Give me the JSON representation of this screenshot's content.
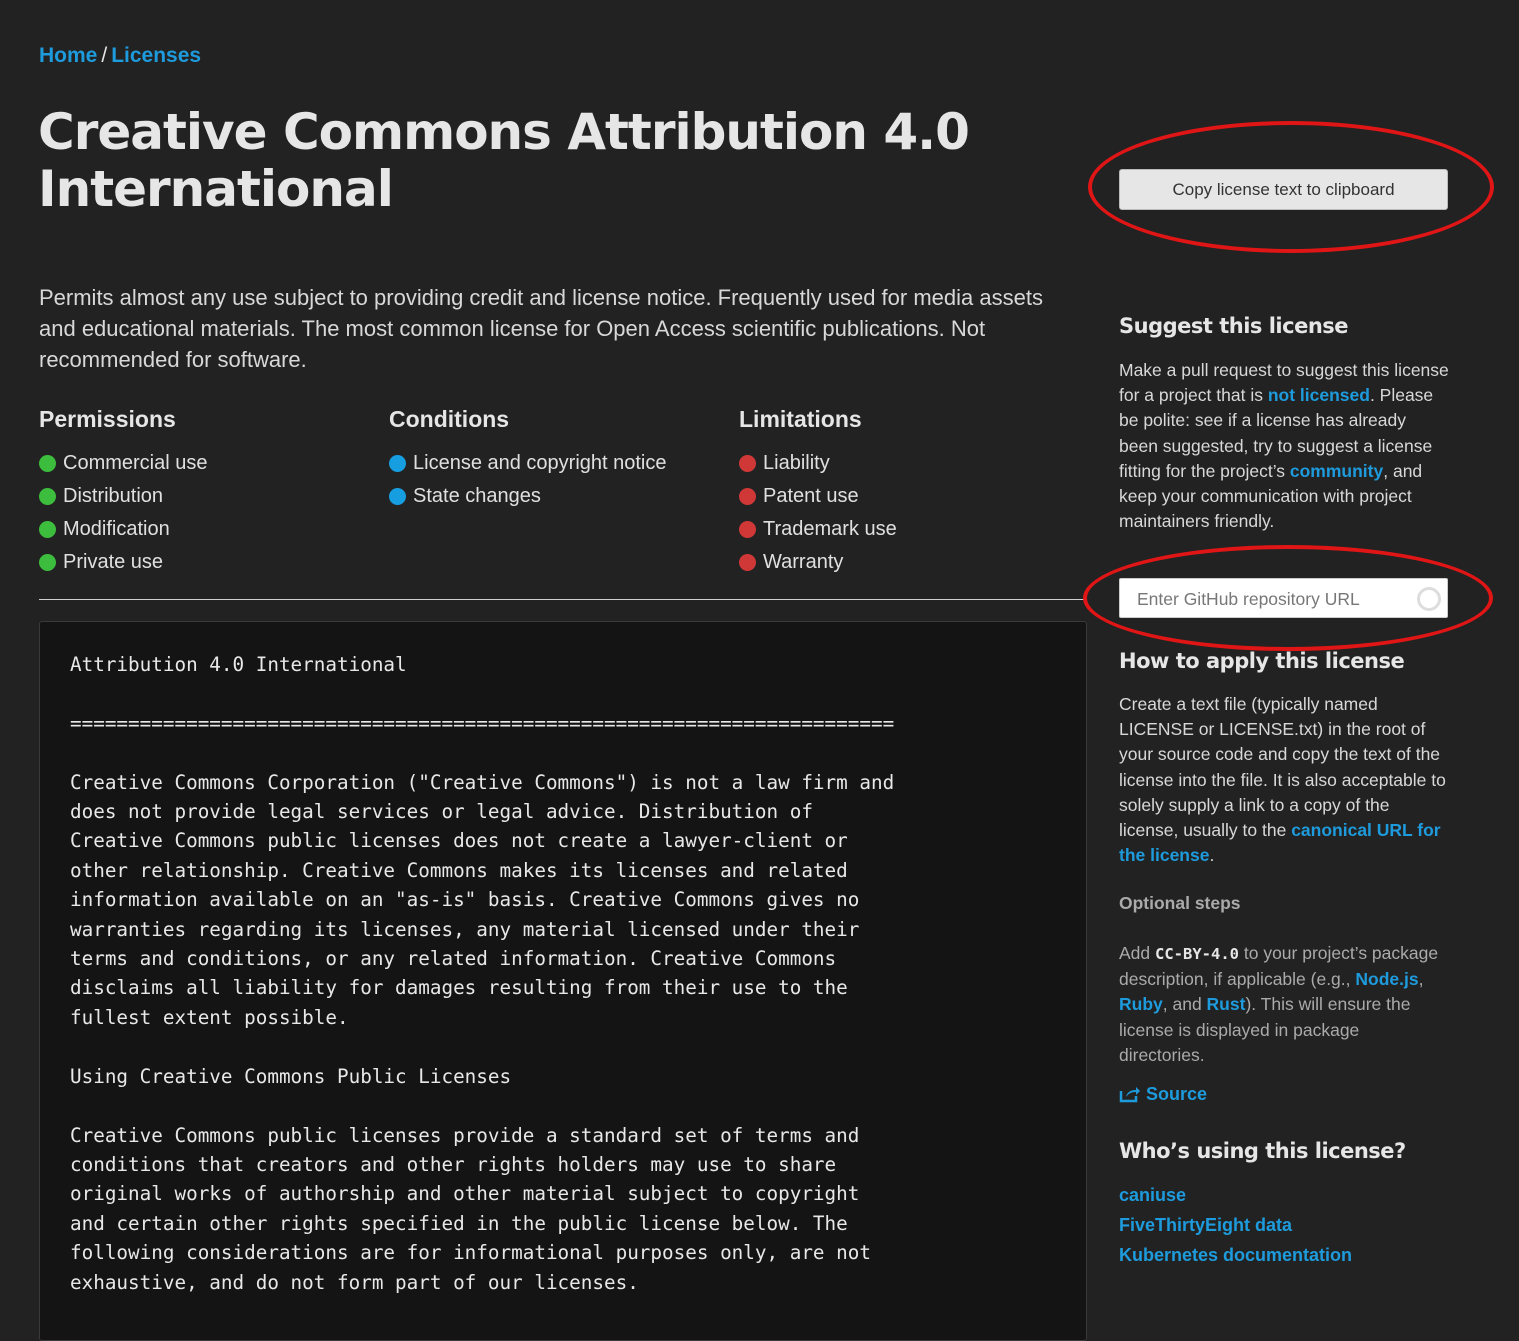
{
  "breadcrumb": {
    "home": "Home",
    "separator": "/",
    "current": "Licenses"
  },
  "title": "Creative Commons Attribution 4.0 International",
  "summary": "Permits almost any use subject to providing credit and license notice. Frequently used for media assets and educational materials. The most common license for Open Access scientific publications. Not recommended for software.",
  "rules": {
    "permissions": {
      "heading": "Permissions",
      "color": "#3dbd3d",
      "items": [
        "Commercial use",
        "Distribution",
        "Modification",
        "Private use"
      ]
    },
    "conditions": {
      "heading": "Conditions",
      "color": "#169ee0",
      "items": [
        "License and copyright notice",
        "State changes"
      ]
    },
    "limitations": {
      "heading": "Limitations",
      "color": "#d03838",
      "items": [
        "Liability",
        "Patent use",
        "Trademark use",
        "Warranty"
      ]
    }
  },
  "license_text": "Attribution 4.0 International\n\n=======================================================================\n\nCreative Commons Corporation (\"Creative Commons\") is not a law firm and\ndoes not provide legal services or legal advice. Distribution of\nCreative Commons public licenses does not create a lawyer-client or\nother relationship. Creative Commons makes its licenses and related\ninformation available on an \"as-is\" basis. Creative Commons gives no\nwarranties regarding its licenses, any material licensed under their\nterms and conditions, or any related information. Creative Commons\ndisclaims all liability for damages resulting from their use to the\nfullest extent possible.\n\nUsing Creative Commons Public Licenses\n\nCreative Commons public licenses provide a standard set of terms and\nconditions that creators and other rights holders may use to share\noriginal works of authorship and other material subject to copyright\nand certain other rights specified in the public license below. The\nfollowing considerations are for informational purposes only, are not\nexhaustive, and do not form part of our licenses.",
  "sidebar": {
    "copy_button": "Copy license text to clipboard",
    "suggest": {
      "heading": "Suggest this license",
      "text1": "Make a pull request to suggest this license for a project that is ",
      "link1": "not licensed",
      "text2": ". Please be polite: see if a license has already been suggested, try to suggest a license fitting for the project’s ",
      "link2": "community",
      "text3": ", and keep your communication with project maintainers friendly.",
      "input_placeholder": "Enter GitHub repository URL"
    },
    "apply": {
      "heading": "How to apply this license",
      "text1": "Create a text file (typically named LICENSE or LICENSE.txt) in the root of your source code and copy the text of the license into the file. It is also acceptable to solely supply a link to a copy of the license, usually to the ",
      "link": "canonical URL for the license",
      "text2": "."
    },
    "optional": {
      "heading": "Optional steps",
      "text1": "Add ",
      "code": "CC-BY-4.0",
      "text2": " to your project’s package description, if applicable (e.g., ",
      "link_node": "Node.js",
      "sep1": ", ",
      "link_ruby": "Ruby",
      "sep2": ", and ",
      "link_rust": "Rust",
      "text3": "). This will ensure the license is displayed in package directories."
    },
    "source_link": "Source",
    "users": {
      "heading": "Who’s using this license?",
      "items": [
        "caniuse",
        "FiveThirtyEight data",
        "Kubernetes documentation"
      ]
    }
  },
  "annotation_color": "#e01515"
}
